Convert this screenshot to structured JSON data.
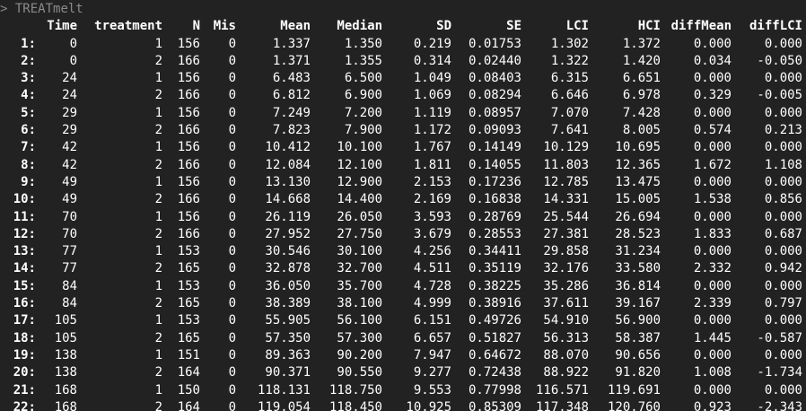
{
  "console": {
    "prompt": ">",
    "command": "TREATmelt"
  },
  "table": {
    "headers": [
      "",
      "Time",
      "treatment",
      "N",
      "Mis",
      "Mean",
      "Median",
      "SD",
      "SE",
      "LCI",
      "HCI",
      "diffMean",
      "diffLCI"
    ],
    "rows": [
      [
        "1:",
        "0",
        "1",
        "156",
        "0",
        "1.337",
        "1.350",
        "0.219",
        "0.01753",
        "1.302",
        "1.372",
        "0.000",
        "0.000"
      ],
      [
        "2:",
        "0",
        "2",
        "166",
        "0",
        "1.371",
        "1.355",
        "0.314",
        "0.02440",
        "1.322",
        "1.420",
        "0.034",
        "-0.050"
      ],
      [
        "3:",
        "24",
        "1",
        "156",
        "0",
        "6.483",
        "6.500",
        "1.049",
        "0.08403",
        "6.315",
        "6.651",
        "0.000",
        "0.000"
      ],
      [
        "4:",
        "24",
        "2",
        "166",
        "0",
        "6.812",
        "6.900",
        "1.069",
        "0.08294",
        "6.646",
        "6.978",
        "0.329",
        "-0.005"
      ],
      [
        "5:",
        "29",
        "1",
        "156",
        "0",
        "7.249",
        "7.200",
        "1.119",
        "0.08957",
        "7.070",
        "7.428",
        "0.000",
        "0.000"
      ],
      [
        "6:",
        "29",
        "2",
        "166",
        "0",
        "7.823",
        "7.900",
        "1.172",
        "0.09093",
        "7.641",
        "8.005",
        "0.574",
        "0.213"
      ],
      [
        "7:",
        "42",
        "1",
        "156",
        "0",
        "10.412",
        "10.100",
        "1.767",
        "0.14149",
        "10.129",
        "10.695",
        "0.000",
        "0.000"
      ],
      [
        "8:",
        "42",
        "2",
        "166",
        "0",
        "12.084",
        "12.100",
        "1.811",
        "0.14055",
        "11.803",
        "12.365",
        "1.672",
        "1.108"
      ],
      [
        "9:",
        "49",
        "1",
        "156",
        "0",
        "13.130",
        "12.900",
        "2.153",
        "0.17236",
        "12.785",
        "13.475",
        "0.000",
        "0.000"
      ],
      [
        "10:",
        "49",
        "2",
        "166",
        "0",
        "14.668",
        "14.400",
        "2.169",
        "0.16838",
        "14.331",
        "15.005",
        "1.538",
        "0.856"
      ],
      [
        "11:",
        "70",
        "1",
        "156",
        "0",
        "26.119",
        "26.050",
        "3.593",
        "0.28769",
        "25.544",
        "26.694",
        "0.000",
        "0.000"
      ],
      [
        "12:",
        "70",
        "2",
        "166",
        "0",
        "27.952",
        "27.750",
        "3.679",
        "0.28553",
        "27.381",
        "28.523",
        "1.833",
        "0.687"
      ],
      [
        "13:",
        "77",
        "1",
        "153",
        "0",
        "30.546",
        "30.100",
        "4.256",
        "0.34411",
        "29.858",
        "31.234",
        "0.000",
        "0.000"
      ],
      [
        "14:",
        "77",
        "2",
        "165",
        "0",
        "32.878",
        "32.700",
        "4.511",
        "0.35119",
        "32.176",
        "33.580",
        "2.332",
        "0.942"
      ],
      [
        "15:",
        "84",
        "1",
        "153",
        "0",
        "36.050",
        "35.700",
        "4.728",
        "0.38225",
        "35.286",
        "36.814",
        "0.000",
        "0.000"
      ],
      [
        "16:",
        "84",
        "2",
        "165",
        "0",
        "38.389",
        "38.100",
        "4.999",
        "0.38916",
        "37.611",
        "39.167",
        "2.339",
        "0.797"
      ],
      [
        "17:",
        "105",
        "1",
        "153",
        "0",
        "55.905",
        "56.100",
        "6.151",
        "0.49726",
        "54.910",
        "56.900",
        "0.000",
        "0.000"
      ],
      [
        "18:",
        "105",
        "2",
        "165",
        "0",
        "57.350",
        "57.300",
        "6.657",
        "0.51827",
        "56.313",
        "58.387",
        "1.445",
        "-0.587"
      ],
      [
        "19:",
        "138",
        "1",
        "151",
        "0",
        "89.363",
        "90.200",
        "7.947",
        "0.64672",
        "88.070",
        "90.656",
        "0.000",
        "0.000"
      ],
      [
        "20:",
        "138",
        "2",
        "164",
        "0",
        "90.371",
        "90.550",
        "9.277",
        "0.72438",
        "88.922",
        "91.820",
        "1.008",
        "-1.734"
      ],
      [
        "21:",
        "168",
        "1",
        "150",
        "0",
        "118.131",
        "118.750",
        "9.553",
        "0.77998",
        "116.571",
        "119.691",
        "0.000",
        "0.000"
      ],
      [
        "22:",
        "168",
        "2",
        "164",
        "0",
        "119.054",
        "118.450",
        "10.925",
        "0.85309",
        "117.348",
        "120.760",
        "0.923",
        "-2.343"
      ]
    ]
  },
  "colors": {
    "background": "#222222",
    "text": "#ffffff",
    "prompt": "#8a8a8a"
  }
}
